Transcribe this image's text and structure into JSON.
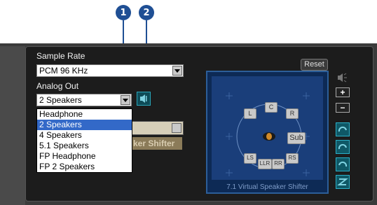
{
  "callouts": [
    "1",
    "2"
  ],
  "sample_rate": {
    "label": "Sample Rate",
    "value": "PCM 96 KHz"
  },
  "analog_out": {
    "label": "Analog Out",
    "value": "2 Speakers",
    "options": [
      "Headphone",
      "2 Speakers",
      "4 Speakers",
      "5.1 Speakers",
      "FP Headphone",
      "FP 2 Speakers"
    ],
    "selected_index": 1
  },
  "shifter_button_partial": "ker Shifter",
  "reset_label": "Reset",
  "virtual_speaker": {
    "caption": "7.1 Virtual Speaker Shifter",
    "speakers": [
      "L",
      "C",
      "R",
      "Sub",
      "LS",
      "RS",
      "LLR",
      "RR"
    ]
  },
  "side_controls": [
    "+",
    "−"
  ],
  "colors": {
    "callout": "#1f4f94",
    "accent_teal": "#2ab0c8",
    "selection": "#3369c8"
  }
}
